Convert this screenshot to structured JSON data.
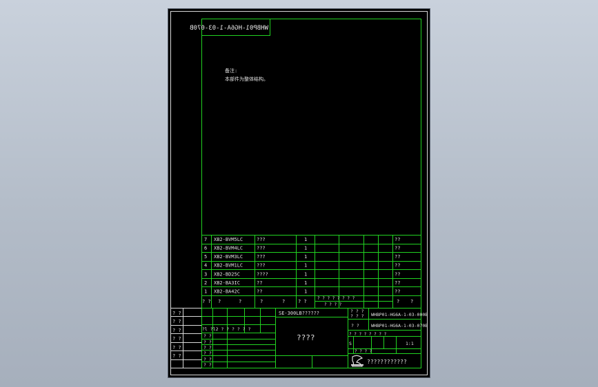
{
  "drawing": {
    "mirrored_code": "WHBP01-HG6A-1-03-070B",
    "notes_title": "备注:",
    "notes_line": "本部件为整体结构。",
    "bom_rows": [
      {
        "no": "7",
        "code": "XB2-BVM5LC",
        "name": "???",
        "qty": "1",
        "remark": "??"
      },
      {
        "no": "6",
        "code": "XB2-BVM4LC",
        "name": "???",
        "qty": "1",
        "remark": "??"
      },
      {
        "no": "5",
        "code": "XB2-BVM3LC",
        "name": "???",
        "qty": "1",
        "remark": "??"
      },
      {
        "no": "4",
        "code": "XB2-BVM1LC",
        "name": "???",
        "qty": "1",
        "remark": "??"
      },
      {
        "no": "3",
        "code": "XB2-BD25C",
        "name": "????",
        "qty": "1",
        "remark": "??"
      },
      {
        "no": "2",
        "code": "XB2-BA3IC",
        "name": "??",
        "qty": "1",
        "remark": "??"
      },
      {
        "no": "1",
        "code": "XB2-BA42C",
        "name": "??",
        "qty": "1",
        "remark": "??"
      }
    ],
    "bom_header": {
      "c1": "? ?",
      "c2": "?",
      "c3": "?",
      "c4": "?",
      "c5": "?",
      "c6": "? ?",
      "mat_top": "?  ?  ?  ?  ?  ?  ? ?",
      "mat_bottom": "?        ?        ?        ?",
      "c8": "?",
      "c9": "?"
    },
    "left_labels": [
      "? ?",
      "? ?",
      "? ?",
      "? ?",
      "? ?",
      "? ?"
    ],
    "rev_header": "?l ?l2 ? ? ? ?   ? ?",
    "rev_rows": [
      "? ?",
      "? ?",
      "? ?",
      "? ?",
      "? ?",
      "? ?"
    ],
    "model_text": "SE-300LB??????",
    "title_main": "????",
    "id_label": "? ? ?\n? ? ?",
    "part_code": "WHBP01-HG6A-1-03-000B",
    "drawing_code": "WHBP01-HG6A-1-03-070B",
    "code_label": "?   ?",
    "stage_header": "? ? ? ?   ? ?   ?   ?",
    "stage_s": "S",
    "scale": "1:1",
    "sheet_row": "?   ?      ?   ?",
    "company": "????????????"
  }
}
